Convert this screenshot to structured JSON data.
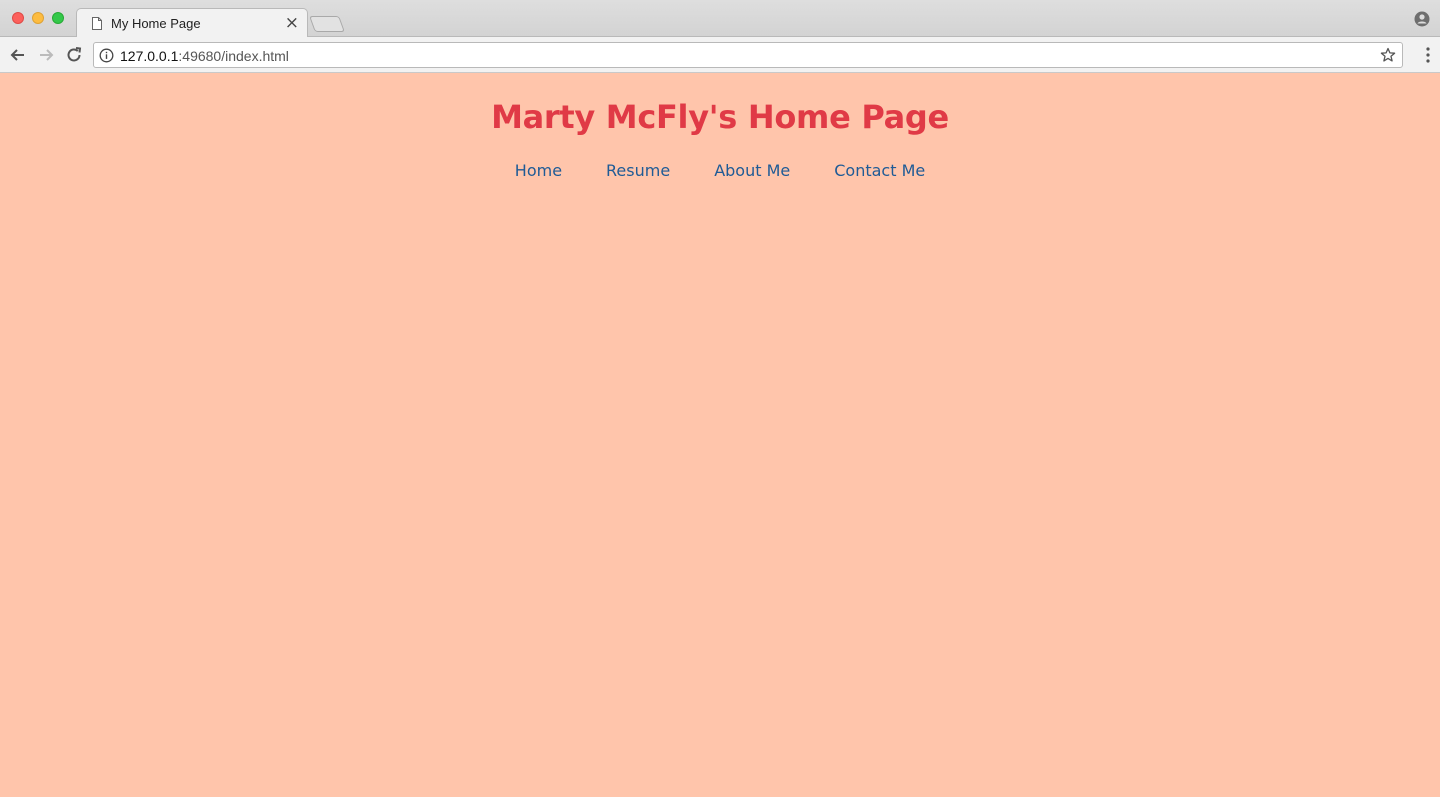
{
  "browser": {
    "tab_title": "My Home Page",
    "tab_close": "×",
    "url_host": "127.0.0.1",
    "url_rest": ":49680/index.html"
  },
  "page": {
    "title": "Marty McFly's Home Page",
    "nav": [
      {
        "label": "Home"
      },
      {
        "label": "Resume"
      },
      {
        "label": "About Me"
      },
      {
        "label": "Contact Me"
      }
    ]
  },
  "colors": {
    "background": "#ffc5ab",
    "title": "#e03a46",
    "nav_link": "#1f5b96"
  }
}
